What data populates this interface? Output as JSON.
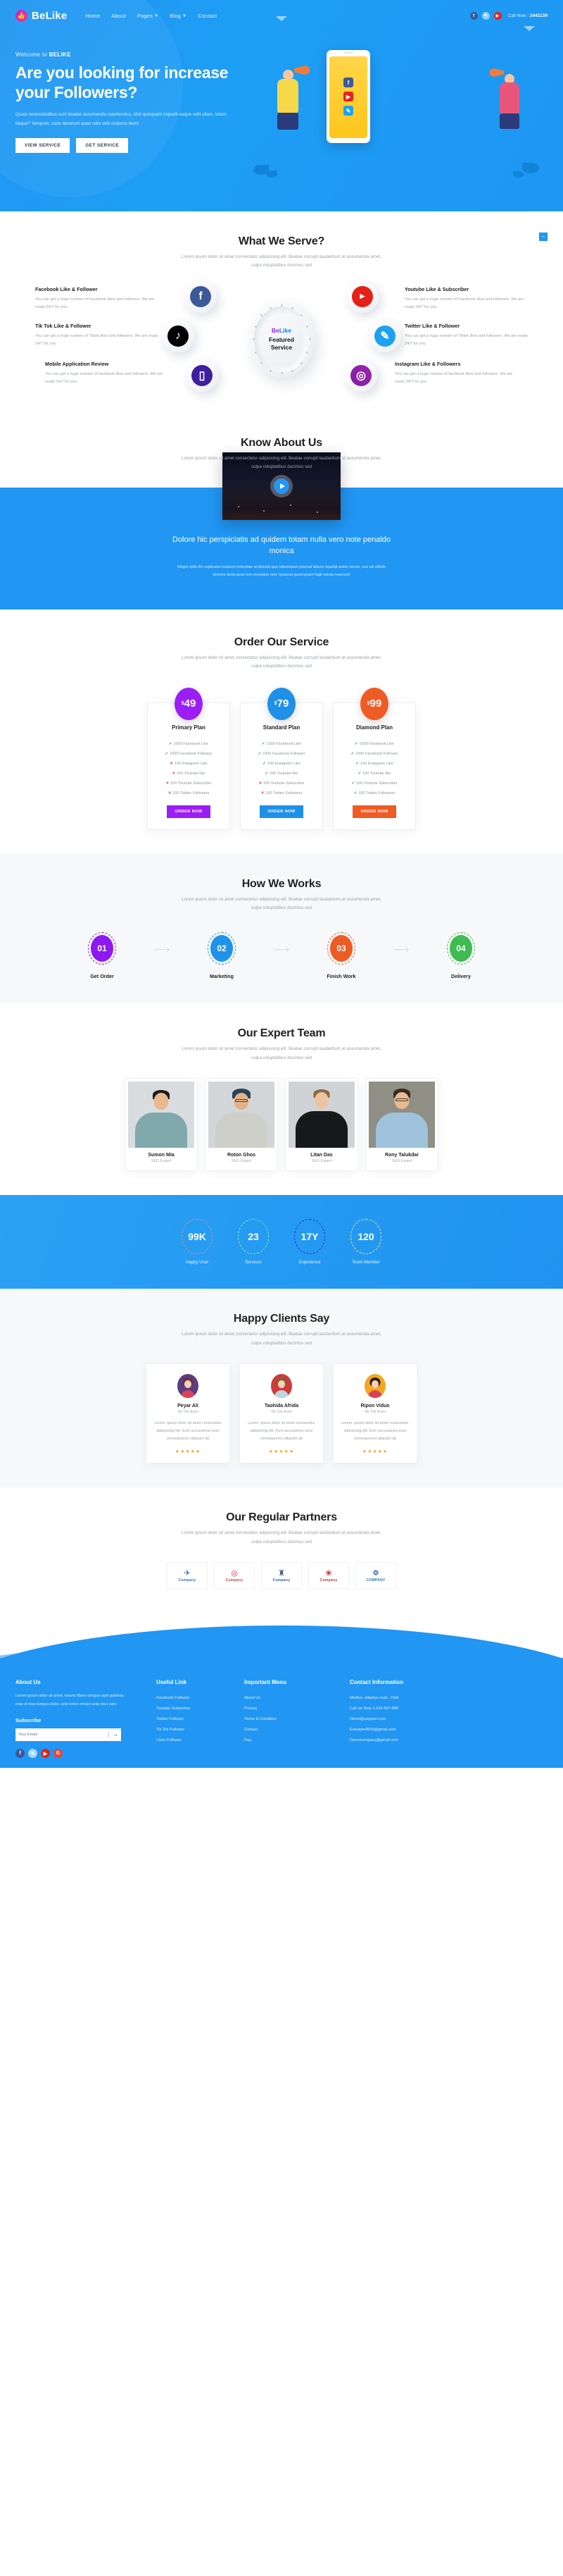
{
  "brand": {
    "name": "BeLike",
    "icon": "thumbs-up-icon"
  },
  "nav": {
    "items": [
      {
        "label": "Home",
        "has_caret": false
      },
      {
        "label": "About",
        "has_caret": false
      },
      {
        "label": "Pages",
        "has_caret": true
      },
      {
        "label": "Blog",
        "has_caret": true
      },
      {
        "label": "Contact",
        "has_caret": false
      }
    ],
    "socials": [
      {
        "name": "facebook-icon",
        "glyph": "f"
      },
      {
        "name": "twitter-icon",
        "glyph": "✉"
      },
      {
        "name": "youtube-icon",
        "glyph": "▶"
      }
    ],
    "call_label": "Call Now :",
    "call_number": "2441139"
  },
  "hero": {
    "welcome_prefix": "Welcome to ",
    "welcome_brand": "BELIKE",
    "title": "Are you looking for increase your Followers?",
    "paragraph": "Quasi necessitatibus sunt beatae assumenda repellendus, nihil quisquam impedit eaque velit ullam, totam itaque? Tempore, iusto deserunt quae odio velit corporis illum!",
    "btn_primary": "VIEW SERVICE",
    "btn_secondary": "GET SERVICE"
  },
  "serve": {
    "title": "What We Serve?",
    "subtitle": "Lorem ipsum dolor sit amet consectetur adipisicing elit. Beatae corrupti laudantium at assumenda amet, culpa voluptatibus ducimus sed",
    "hub": {
      "brand_be": "Be",
      "brand_like": "Like",
      "line1": "Featured",
      "line2": "Service"
    },
    "items": [
      {
        "title": "Facebook Like & Follower",
        "text": "You can get a huge number of Facebook likes and followers. We are ready 24/7 for you.",
        "icon": "facebook-icon",
        "glyph": "f"
      },
      {
        "title": "Youtube Like & Subscriber",
        "text": "You can get a huge number of Facebook likes and followers. We are ready 24/7 for you.",
        "icon": "youtube-icon",
        "glyph": "You Tube"
      },
      {
        "title": "Tik Tok Like & Follower",
        "text": "You can get a huge number of Tiktok likes and followers. We are ready 24/7 for you.",
        "icon": "tiktok-icon",
        "glyph": "♪"
      },
      {
        "title": "Twitter Like & Follower",
        "text": "You can get a huge number of Tiktok likes and followers. We are ready 24/7 for you.",
        "icon": "twitter-icon",
        "glyph": "✉"
      },
      {
        "title": "Mobile Application Review",
        "text": "You can get a huge number of facebook likes and followers. We are ready 24/7 for you.",
        "icon": "mobile-icon",
        "glyph": "▯"
      },
      {
        "title": "Instagram Like & Followers",
        "text": "You can get a huge number of facebook likes and followers. We are ready 24/7 for you.",
        "icon": "instagram-icon",
        "glyph": "◎"
      }
    ]
  },
  "about": {
    "title": "Know About Us",
    "subtitle": "Lorem ipsum dolor sit amet consectetur adipisicing elit. Beatae corrupti laudantium at assumenda amet, culpa voluptatibus ducimus sed",
    "video_icon": "play-icon",
    "headline": "Dolore hic perspiciatis ad quidem totam nulla vero note penaldo monica",
    "paragraph": "Magni optio illo explicabo incidunt molestiae id deleniti quis laboriosam placeat labore repellat animi earum, iure ad officiis dolores dicta quod rem excepturi non! Quaerat quod ipsam fugit soluta nesciunt!"
  },
  "pricing": {
    "title": "Order Our Service",
    "subtitle": "Lorem ipsum dolor sit amet consectetur adipisicing elit. Beatae corrupti laudantium at assumenda amet, culpa voluptatibus ducimus sed",
    "currency": "$",
    "plans": [
      {
        "price": "49",
        "name": "Primary Plan",
        "color": "#9c1ef5",
        "button": "ORDER NOW",
        "features": [
          {
            "text": "1000 Facebook Like",
            "included": true
          },
          {
            "text": "1000 Facebook Follower",
            "included": true
          },
          {
            "text": "100 Instagram Like",
            "included": false
          },
          {
            "text": "100 Youtube like",
            "included": false
          },
          {
            "text": "100 Youtube Subscriber",
            "included": false
          },
          {
            "text": "100 Twitter Followers",
            "included": false
          }
        ]
      },
      {
        "price": "79",
        "name": "Standard Plan",
        "color": "#1e90e8",
        "button": "ORDER NOW",
        "features": [
          {
            "text": "1000 Facebook Like",
            "included": true
          },
          {
            "text": "1000 Facebook Follower",
            "included": true
          },
          {
            "text": "100 Instagram Like",
            "included": true
          },
          {
            "text": "100 Youtube like",
            "included": true
          },
          {
            "text": "100 Youtube Subscriber",
            "included": false
          },
          {
            "text": "100 Twitter Followers",
            "included": false
          }
        ]
      },
      {
        "price": "99",
        "name": "Diamond Plan",
        "color": "#ef5b25",
        "button": "ORDER NOW",
        "features": [
          {
            "text": "1000 Facebook Like",
            "included": true
          },
          {
            "text": "1000 Facebook Follower",
            "included": true
          },
          {
            "text": "100 Instagram Like",
            "included": true
          },
          {
            "text": "100 Youtube like",
            "included": true
          },
          {
            "text": "100 Youtube Subscriber",
            "included": true
          },
          {
            "text": "100 Twitter Followers",
            "included": true
          }
        ]
      }
    ]
  },
  "works": {
    "title": "How We Works",
    "subtitle": "Lorem ipsum dolor sit amet consectetur adipisicing elit. Beatae corrupti laudantium at assumenda amet, culpa voluptatibus ducimus sed",
    "steps": [
      {
        "num": "01",
        "label": "Get Order",
        "color": "#8e19f0"
      },
      {
        "num": "02",
        "label": "Marketing",
        "color": "#1f93ea"
      },
      {
        "num": "03",
        "label": "Finish Work",
        "color": "#ef5b25"
      },
      {
        "num": "04",
        "label": "Delivery",
        "color": "#3fbb52"
      }
    ]
  },
  "team": {
    "title": "Our Expert Team",
    "subtitle": "Lorem ipsum dolor sit amet consectetur adipisicing elit. Beatae corrupti laudantium at assumenda amet, culpa voluptatibus ducimus sed",
    "members": [
      {
        "name": "Sumon Mia",
        "role": "SEO Expert"
      },
      {
        "name": "Roton Ghos",
        "role": "SEO Expert"
      },
      {
        "name": "Litan Das",
        "role": "SEO Expert"
      },
      {
        "name": "Rony Talukdar",
        "role": "SEO Expert"
      }
    ]
  },
  "counters": {
    "items": [
      {
        "value": "99K",
        "label": "Happy User",
        "ring": "#e9897b"
      },
      {
        "value": "23",
        "label": "Services",
        "ring": "#7ef0a3"
      },
      {
        "value": "17Y",
        "label": "Experience",
        "ring": "#3a2bd8"
      },
      {
        "value": "120",
        "label": "Team Member",
        "ring": "#f7e08a"
      }
    ]
  },
  "testimonials": {
    "title": "Happy Clients Say",
    "subtitle": "Lorem ipsum dolor sit amet consectetur adipisicing elit. Beatae corrupti laudantium at assumenda amet, culpa voluptatibus ducimus sed",
    "items": [
      {
        "name": "Peyar Ali",
        "role": "Tik Tok Actor",
        "text": "Lorem, ipsum dolor sit amet consectetur adipisicing elit. Eum accusamus esse consequuntur aliquam ab",
        "stars": "★★★★★"
      },
      {
        "name": "Taohida Afrida",
        "role": "Tik Tok Actor",
        "text": "Lorem, ipsum dolor sit amet consectetur adipisicing elit. Eum accusamus esse consequuntur aliquam ab",
        "stars": "★★★★★"
      },
      {
        "name": "Ripon Viduo",
        "role": "Tik Tok Actor",
        "text": "Lorem, ipsum dolor sit amet consectetur adipisicing elit. Eum accusamus esse consequuntur aliquam ab",
        "stars": "★★★★★"
      }
    ]
  },
  "partners": {
    "title": "Our Regular Partners",
    "subtitle": "Lorem ipsum dolor sit amet consectetur adipisicing elit. Beatae corrupti laudantium at assumenda amet, culpa voluptatibus ducimus sed",
    "logos": [
      {
        "text": "Company",
        "mark": "✈",
        "color": "#2f6fb5"
      },
      {
        "text": "Company",
        "mark": "◎",
        "color": "#d03a3a"
      },
      {
        "text": "Company",
        "mark": "♜",
        "color": "#3a5a8c"
      },
      {
        "text": "Company",
        "mark": "❀",
        "color": "#c0392b"
      },
      {
        "text": "COMPANY",
        "mark": "❁",
        "color": "#2f6fb5"
      }
    ]
  },
  "footer": {
    "about": {
      "heading": "About Us",
      "text": "Lorem ipsum dolor sit amet, mauris libero congue eget pulvinar, cras ut mus tempus dolor, ante tortor ornare ante arcu nam",
      "subscribe_heading": "Subscribe",
      "email_placeholder": "Your Email",
      "email_value": "",
      "send_icon": "arrow-right-icon"
    },
    "socials": [
      {
        "name": "facebook-icon",
        "glyph": "f"
      },
      {
        "name": "twitter-icon",
        "glyph": "✉"
      },
      {
        "name": "youtube-icon",
        "glyph": "▶"
      },
      {
        "name": "google-plus-icon",
        "glyph": "G+"
      }
    ],
    "useful": {
      "heading": "Useful Link",
      "links": [
        "Facebook Follower",
        "Youtube Subscriber",
        "Twitter Follower",
        "Tik Tok Follower",
        "Likee Follower"
      ]
    },
    "important": {
      "heading": "Important Menu",
      "links": [
        "About Us",
        "Privacy",
        "Terms & Condition",
        "Contact",
        "Faq"
      ]
    },
    "contact": {
      "heading": "Contact Information",
      "lines": [
        "Medino, kitaniya road , USA",
        "Call Us Now 1-234-567-890",
        "Demo@support.com",
        "Exmaple4500@gmail.com",
        "Democompany@gmail.com"
      ]
    }
  }
}
